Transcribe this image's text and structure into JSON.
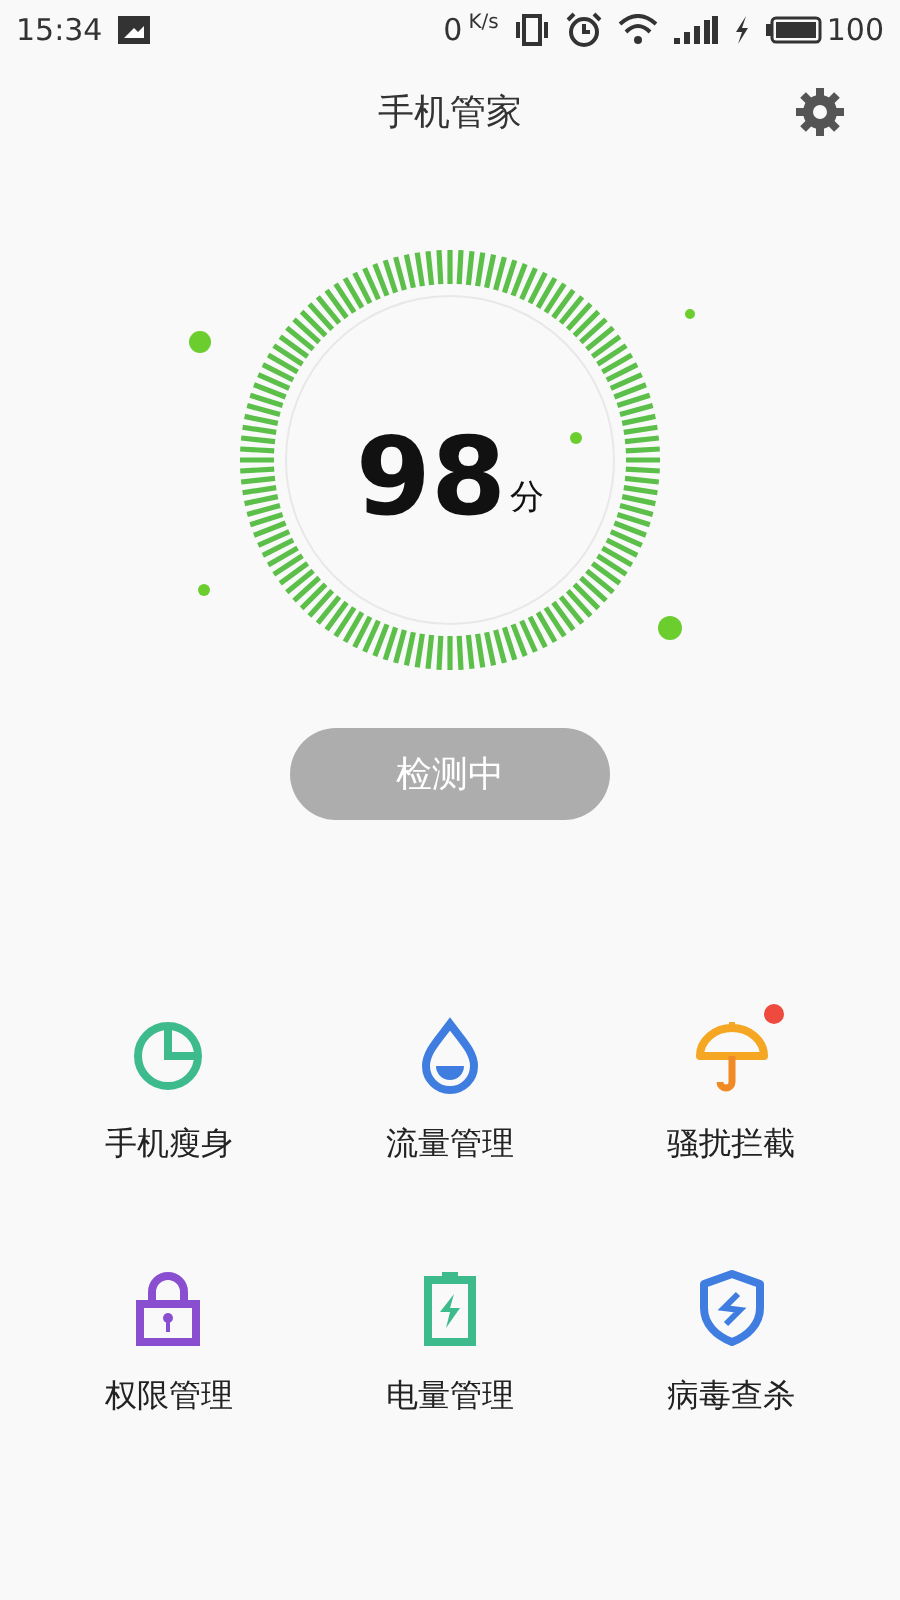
{
  "status_bar": {
    "time": "15:34",
    "speed_value": "0",
    "speed_unit": "K/s",
    "battery": "100"
  },
  "header": {
    "title": "手机管家"
  },
  "score": {
    "value": "98",
    "unit": "分"
  },
  "scan_button": {
    "label": "检测中",
    "disabled": true
  },
  "tools": [
    {
      "kind": "pie",
      "label": "手机瘦身",
      "badge": false
    },
    {
      "kind": "drop",
      "label": "流量管理",
      "badge": false
    },
    {
      "kind": "umbrella",
      "label": "骚扰拦截",
      "badge": true
    },
    {
      "kind": "lock",
      "label": "权限管理",
      "badge": false
    },
    {
      "kind": "battery",
      "label": "电量管理",
      "badge": false
    },
    {
      "kind": "shield",
      "label": "病毒查杀",
      "badge": false
    }
  ]
}
